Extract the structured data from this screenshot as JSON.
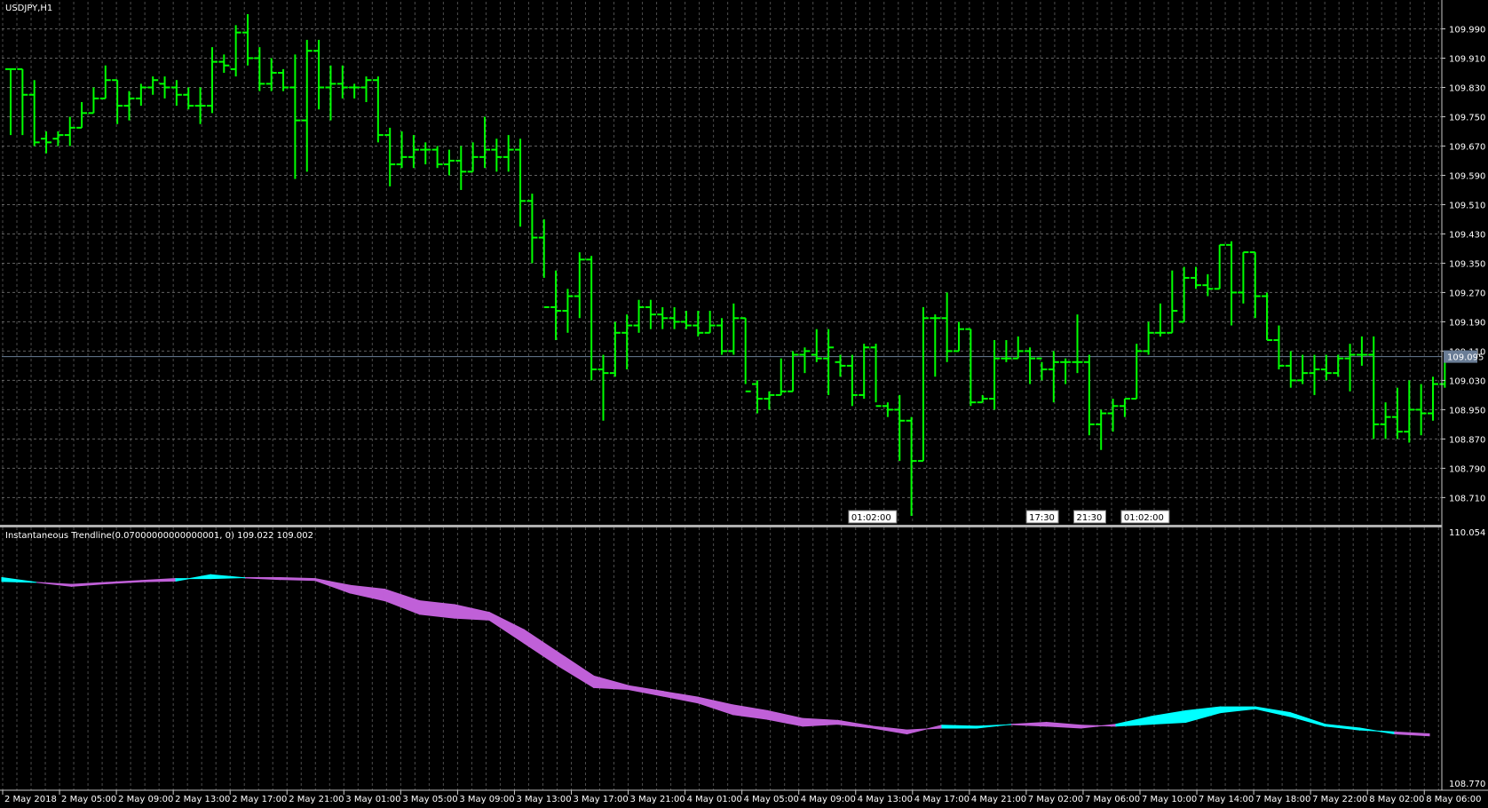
{
  "window": {
    "symbol_title": "USDJPY,H1",
    "indicator_title": "Instantaneous Trendline(0.07000000000000001, 0) 109.022 109.002"
  },
  "colors": {
    "background": "#000000",
    "grid": "#8a8a8a",
    "bars": "#00ff00",
    "axis": "#c8c8c8",
    "text": "#ffffff",
    "trend_up": "#00ffff",
    "trend_down": "#c060d8",
    "price_line": "#6a7d96",
    "current_price_label_bg": "#6a7d96"
  },
  "main_axis": {
    "ticks": [
      "109.990",
      "109.910",
      "109.830",
      "109.750",
      "109.670",
      "109.590",
      "109.510",
      "109.430",
      "109.350",
      "109.270",
      "109.190",
      "109.110",
      "109.030",
      "108.950",
      "108.870",
      "108.790",
      "108.710"
    ],
    "current_price": "109.095"
  },
  "indicator_axis": {
    "top": "110.054",
    "bottom": "108.770"
  },
  "time_axis": {
    "labels": [
      "2 May 2018",
      "2 May 05:00",
      "2 May 09:00",
      "2 May 13:00",
      "2 May 17:00",
      "2 May 21:00",
      "3 May 01:00",
      "3 May 05:00",
      "3 May 09:00",
      "3 May 13:00",
      "3 May 17:00",
      "3 May 21:00",
      "4 May 01:00",
      "4 May 05:00",
      "4 May 09:00",
      "4 May 13:00",
      "4 May 17:00",
      "4 May 21:00",
      "7 May 02:00",
      "7 May 06:00",
      "7 May 10:00",
      "7 May 14:00",
      "7 May 18:00",
      "7 May 22:00",
      "8 May 02:00",
      "8 May 06:00"
    ]
  },
  "markers": [
    {
      "text": "01:02:00",
      "bar": 71
    },
    {
      "text": "17:30",
      "bar": 86
    },
    {
      "text": "21:30",
      "bar": 90
    },
    {
      "text": "01:02:00",
      "bar": 94
    }
  ],
  "chart_data": [
    {
      "type": "ohlc",
      "title": "USDJPY,H1",
      "ylim": [
        108.66,
        110.03
      ],
      "bars": [
        {
          "o": 109.88,
          "h": 109.88,
          "l": 109.7,
          "c": 109.88
        },
        {
          "o": 109.88,
          "h": 109.88,
          "l": 109.7,
          "c": 109.81
        },
        {
          "o": 109.81,
          "h": 109.85,
          "l": 109.67,
          "c": 109.68
        },
        {
          "o": 109.69,
          "h": 109.71,
          "l": 109.65,
          "c": 109.68
        },
        {
          "o": 109.69,
          "h": 109.71,
          "l": 109.67,
          "c": 109.7
        },
        {
          "o": 109.7,
          "h": 109.75,
          "l": 109.67,
          "c": 109.72
        },
        {
          "o": 109.72,
          "h": 109.79,
          "l": 109.72,
          "c": 109.76
        },
        {
          "o": 109.76,
          "h": 109.83,
          "l": 109.76,
          "c": 109.8
        },
        {
          "o": 109.8,
          "h": 109.89,
          "l": 109.8,
          "c": 109.85
        },
        {
          "o": 109.85,
          "h": 109.85,
          "l": 109.73,
          "c": 109.78
        },
        {
          "o": 109.78,
          "h": 109.82,
          "l": 109.74,
          "c": 109.8
        },
        {
          "o": 109.8,
          "h": 109.84,
          "l": 109.78,
          "c": 109.83
        },
        {
          "o": 109.83,
          "h": 109.86,
          "l": 109.81,
          "c": 109.85
        },
        {
          "o": 109.84,
          "h": 109.86,
          "l": 109.8,
          "c": 109.83
        },
        {
          "o": 109.83,
          "h": 109.85,
          "l": 109.78,
          "c": 109.81
        },
        {
          "o": 109.81,
          "h": 109.83,
          "l": 109.77,
          "c": 109.78
        },
        {
          "o": 109.78,
          "h": 109.83,
          "l": 109.73,
          "c": 109.78
        },
        {
          "o": 109.78,
          "h": 109.94,
          "l": 109.76,
          "c": 109.9
        },
        {
          "o": 109.9,
          "h": 109.92,
          "l": 109.87,
          "c": 109.89
        },
        {
          "o": 109.88,
          "h": 110.0,
          "l": 109.86,
          "c": 109.98
        },
        {
          "o": 109.98,
          "h": 110.03,
          "l": 109.89,
          "c": 109.91
        },
        {
          "o": 109.91,
          "h": 109.94,
          "l": 109.82,
          "c": 109.84
        },
        {
          "o": 109.84,
          "h": 109.91,
          "l": 109.82,
          "c": 109.87
        },
        {
          "o": 109.87,
          "h": 109.88,
          "l": 109.82,
          "c": 109.83
        },
        {
          "o": 109.83,
          "h": 109.92,
          "l": 109.58,
          "c": 109.74
        },
        {
          "o": 109.74,
          "h": 109.96,
          "l": 109.6,
          "c": 109.93
        },
        {
          "o": 109.93,
          "h": 109.96,
          "l": 109.77,
          "c": 109.83
        },
        {
          "o": 109.83,
          "h": 109.89,
          "l": 109.74,
          "c": 109.84
        },
        {
          "o": 109.84,
          "h": 109.89,
          "l": 109.8,
          "c": 109.83
        },
        {
          "o": 109.83,
          "h": 109.84,
          "l": 109.8,
          "c": 109.83
        },
        {
          "o": 109.83,
          "h": 109.86,
          "l": 109.79,
          "c": 109.85
        },
        {
          "o": 109.85,
          "h": 109.86,
          "l": 109.68,
          "c": 109.7
        },
        {
          "o": 109.7,
          "h": 109.72,
          "l": 109.56,
          "c": 109.62
        },
        {
          "o": 109.62,
          "h": 109.71,
          "l": 109.61,
          "c": 109.64
        },
        {
          "o": 109.64,
          "h": 109.7,
          "l": 109.61,
          "c": 109.66
        },
        {
          "o": 109.66,
          "h": 109.68,
          "l": 109.62,
          "c": 109.66
        },
        {
          "o": 109.66,
          "h": 109.67,
          "l": 109.61,
          "c": 109.62
        },
        {
          "o": 109.62,
          "h": 109.66,
          "l": 109.59,
          "c": 109.63
        },
        {
          "o": 109.63,
          "h": 109.67,
          "l": 109.55,
          "c": 109.6
        },
        {
          "o": 109.6,
          "h": 109.68,
          "l": 109.6,
          "c": 109.64
        },
        {
          "o": 109.64,
          "h": 109.75,
          "l": 109.61,
          "c": 109.66
        },
        {
          "o": 109.66,
          "h": 109.69,
          "l": 109.6,
          "c": 109.64
        },
        {
          "o": 109.64,
          "h": 109.7,
          "l": 109.6,
          "c": 109.66
        },
        {
          "o": 109.66,
          "h": 109.69,
          "l": 109.45,
          "c": 109.52
        },
        {
          "o": 109.52,
          "h": 109.54,
          "l": 109.35,
          "c": 109.42
        },
        {
          "o": 109.42,
          "h": 109.47,
          "l": 109.31,
          "c": 109.23
        },
        {
          "o": 109.23,
          "h": 109.33,
          "l": 109.14,
          "c": 109.22
        },
        {
          "o": 109.22,
          "h": 109.28,
          "l": 109.16,
          "c": 109.26
        },
        {
          "o": 109.26,
          "h": 109.38,
          "l": 109.2,
          "c": 109.36
        },
        {
          "o": 109.36,
          "h": 109.37,
          "l": 109.03,
          "c": 109.06
        },
        {
          "o": 109.06,
          "h": 109.1,
          "l": 108.92,
          "c": 109.05
        },
        {
          "o": 109.05,
          "h": 109.19,
          "l": 109.04,
          "c": 109.16
        },
        {
          "o": 109.16,
          "h": 109.21,
          "l": 109.06,
          "c": 109.18
        },
        {
          "o": 109.18,
          "h": 109.25,
          "l": 109.16,
          "c": 109.23
        },
        {
          "o": 109.23,
          "h": 109.25,
          "l": 109.17,
          "c": 109.21
        },
        {
          "o": 109.21,
          "h": 109.23,
          "l": 109.17,
          "c": 109.2
        },
        {
          "o": 109.2,
          "h": 109.23,
          "l": 109.17,
          "c": 109.19
        },
        {
          "o": 109.19,
          "h": 109.22,
          "l": 109.17,
          "c": 109.18
        },
        {
          "o": 109.18,
          "h": 109.22,
          "l": 109.15,
          "c": 109.16
        },
        {
          "o": 109.16,
          "h": 109.22,
          "l": 109.16,
          "c": 109.18
        },
        {
          "o": 109.18,
          "h": 109.2,
          "l": 109.1,
          "c": 109.11
        },
        {
          "o": 109.11,
          "h": 109.24,
          "l": 109.1,
          "c": 109.2
        },
        {
          "o": 109.2,
          "h": 109.2,
          "l": 109.02,
          "c": 109.0
        },
        {
          "o": 109.02,
          "h": 109.03,
          "l": 108.94,
          "c": 108.98
        },
        {
          "o": 108.98,
          "h": 109.0,
          "l": 108.95,
          "c": 108.99
        },
        {
          "o": 108.99,
          "h": 109.09,
          "l": 108.99,
          "c": 109.0
        },
        {
          "o": 109.0,
          "h": 109.11,
          "l": 109.0,
          "c": 109.1
        },
        {
          "o": 109.1,
          "h": 109.12,
          "l": 109.05,
          "c": 109.11
        },
        {
          "o": 109.1,
          "h": 109.17,
          "l": 109.08,
          "c": 109.09
        },
        {
          "o": 109.09,
          "h": 109.17,
          "l": 108.99,
          "c": 109.12
        },
        {
          "o": 109.08,
          "h": 109.1,
          "l": 109.04,
          "c": 109.07
        },
        {
          "o": 109.07,
          "h": 109.1,
          "l": 108.96,
          "c": 108.99
        },
        {
          "o": 108.99,
          "h": 109.13,
          "l": 108.98,
          "c": 109.12
        },
        {
          "o": 109.12,
          "h": 109.13,
          "l": 108.97,
          "c": 108.96
        },
        {
          "o": 108.96,
          "h": 108.97,
          "l": 108.93,
          "c": 108.95
        },
        {
          "o": 108.95,
          "h": 108.99,
          "l": 108.81,
          "c": 108.92
        },
        {
          "o": 108.92,
          "h": 108.93,
          "l": 108.66,
          "c": 108.81
        },
        {
          "o": 108.81,
          "h": 109.23,
          "l": 108.81,
          "c": 109.2
        },
        {
          "o": 109.2,
          "h": 109.21,
          "l": 109.04,
          "c": 109.2
        },
        {
          "o": 109.2,
          "h": 109.27,
          "l": 109.08,
          "c": 109.11
        },
        {
          "o": 109.11,
          "h": 109.19,
          "l": 109.11,
          "c": 109.17
        },
        {
          "o": 109.17,
          "h": 109.17,
          "l": 108.96,
          "c": 108.97
        },
        {
          "o": 108.97,
          "h": 108.99,
          "l": 108.97,
          "c": 108.98
        },
        {
          "o": 108.98,
          "h": 109.14,
          "l": 108.95,
          "c": 109.09
        },
        {
          "o": 109.09,
          "h": 109.14,
          "l": 109.08,
          "c": 109.09
        },
        {
          "o": 109.09,
          "h": 109.15,
          "l": 109.09,
          "c": 109.11
        },
        {
          "o": 109.11,
          "h": 109.12,
          "l": 109.02,
          "c": 109.09
        },
        {
          "o": 109.09,
          "h": 109.08,
          "l": 109.03,
          "c": 109.06
        },
        {
          "o": 109.06,
          "h": 109.11,
          "l": 108.97,
          "c": 109.08
        },
        {
          "o": 109.08,
          "h": 109.09,
          "l": 109.02,
          "c": 109.08
        },
        {
          "o": 109.08,
          "h": 109.21,
          "l": 109.05,
          "c": 109.08
        },
        {
          "o": 109.08,
          "h": 109.1,
          "l": 108.88,
          "c": 108.91
        },
        {
          "o": 108.91,
          "h": 108.95,
          "l": 108.84,
          "c": 108.94
        },
        {
          "o": 108.94,
          "h": 108.98,
          "l": 108.89,
          "c": 108.96
        },
        {
          "o": 108.96,
          "h": 108.98,
          "l": 108.93,
          "c": 108.98
        },
        {
          "o": 108.98,
          "h": 109.13,
          "l": 108.98,
          "c": 109.11
        },
        {
          "o": 109.11,
          "h": 109.19,
          "l": 109.1,
          "c": 109.16
        },
        {
          "o": 109.16,
          "h": 109.24,
          "l": 109.15,
          "c": 109.16
        },
        {
          "o": 109.16,
          "h": 109.33,
          "l": 109.16,
          "c": 109.22
        },
        {
          "o": 109.19,
          "h": 109.34,
          "l": 109.19,
          "c": 109.31
        },
        {
          "o": 109.31,
          "h": 109.34,
          "l": 109.28,
          "c": 109.29
        },
        {
          "o": 109.29,
          "h": 109.32,
          "l": 109.26,
          "c": 109.28
        },
        {
          "o": 109.28,
          "h": 109.4,
          "l": 109.28,
          "c": 109.4
        },
        {
          "o": 109.4,
          "h": 109.41,
          "l": 109.18,
          "c": 109.27
        },
        {
          "o": 109.27,
          "h": 109.38,
          "l": 109.24,
          "c": 109.38
        },
        {
          "o": 109.38,
          "h": 109.38,
          "l": 109.2,
          "c": 109.26
        },
        {
          "o": 109.26,
          "h": 109.27,
          "l": 109.14,
          "c": 109.14
        },
        {
          "o": 109.14,
          "h": 109.18,
          "l": 109.06,
          "c": 109.07
        },
        {
          "o": 109.07,
          "h": 109.11,
          "l": 109.01,
          "c": 109.03
        },
        {
          "o": 109.03,
          "h": 109.1,
          "l": 109.02,
          "c": 109.05
        },
        {
          "o": 109.05,
          "h": 109.1,
          "l": 108.99,
          "c": 109.06
        },
        {
          "o": 109.06,
          "h": 109.1,
          "l": 109.03,
          "c": 109.05
        },
        {
          "o": 109.05,
          "h": 109.1,
          "l": 109.04,
          "c": 109.09
        },
        {
          "o": 109.09,
          "h": 109.13,
          "l": 109.0,
          "c": 109.1
        },
        {
          "o": 109.1,
          "h": 109.15,
          "l": 109.07,
          "c": 109.1
        },
        {
          "o": 109.1,
          "h": 109.15,
          "l": 108.87,
          "c": 108.91
        },
        {
          "o": 108.91,
          "h": 108.97,
          "l": 108.87,
          "c": 108.93
        },
        {
          "o": 108.93,
          "h": 109.01,
          "l": 108.87,
          "c": 108.89
        },
        {
          "o": 108.89,
          "h": 109.03,
          "l": 108.86,
          "c": 108.95
        },
        {
          "o": 108.95,
          "h": 109.02,
          "l": 108.88,
          "c": 108.94
        },
        {
          "o": 108.94,
          "h": 109.04,
          "l": 108.92,
          "c": 109.02
        },
        {
          "o": 109.02,
          "h": 109.11,
          "l": 109.01,
          "c": 109.1
        }
      ]
    },
    {
      "type": "area",
      "title": "Instantaneous Trendline(0.07000000000000001, 0) 109.022 109.002",
      "ylim": [
        108.77,
        110.054
      ],
      "series": [
        {
          "name": "109.022",
          "values": [
            109.82,
            109.815,
            109.805,
            109.815,
            109.825,
            109.835,
            109.835,
            109.84,
            109.84,
            109.835,
            109.8,
            109.78,
            109.72,
            109.7,
            109.66,
            109.57,
            109.45,
            109.33,
            109.28,
            109.25,
            109.22,
            109.18,
            109.15,
            109.11,
            109.1,
            109.07,
            109.05,
            109.06,
            109.06,
            109.08,
            109.09,
            109.075,
            109.07,
            109.08,
            109.09,
            109.14,
            109.16,
            109.12,
            109.07,
            109.05,
            109.04,
            109.03
          ]
        },
        {
          "name": "109.002",
          "values": [
            109.84,
            109.815,
            109.795,
            109.808,
            109.818,
            109.822,
            109.855,
            109.838,
            109.83,
            109.825,
            109.76,
            109.72,
            109.65,
            109.63,
            109.62,
            109.5,
            109.38,
            109.27,
            109.26,
            109.225,
            109.19,
            109.13,
            109.105,
            109.07,
            109.08,
            109.06,
            109.03,
            109.075,
            109.07,
            109.078,
            109.07,
            109.06,
            109.08,
            109.12,
            109.15,
            109.17,
            109.17,
            109.14,
            109.08,
            109.06,
            109.03,
            109.02
          ]
        }
      ]
    }
  ]
}
